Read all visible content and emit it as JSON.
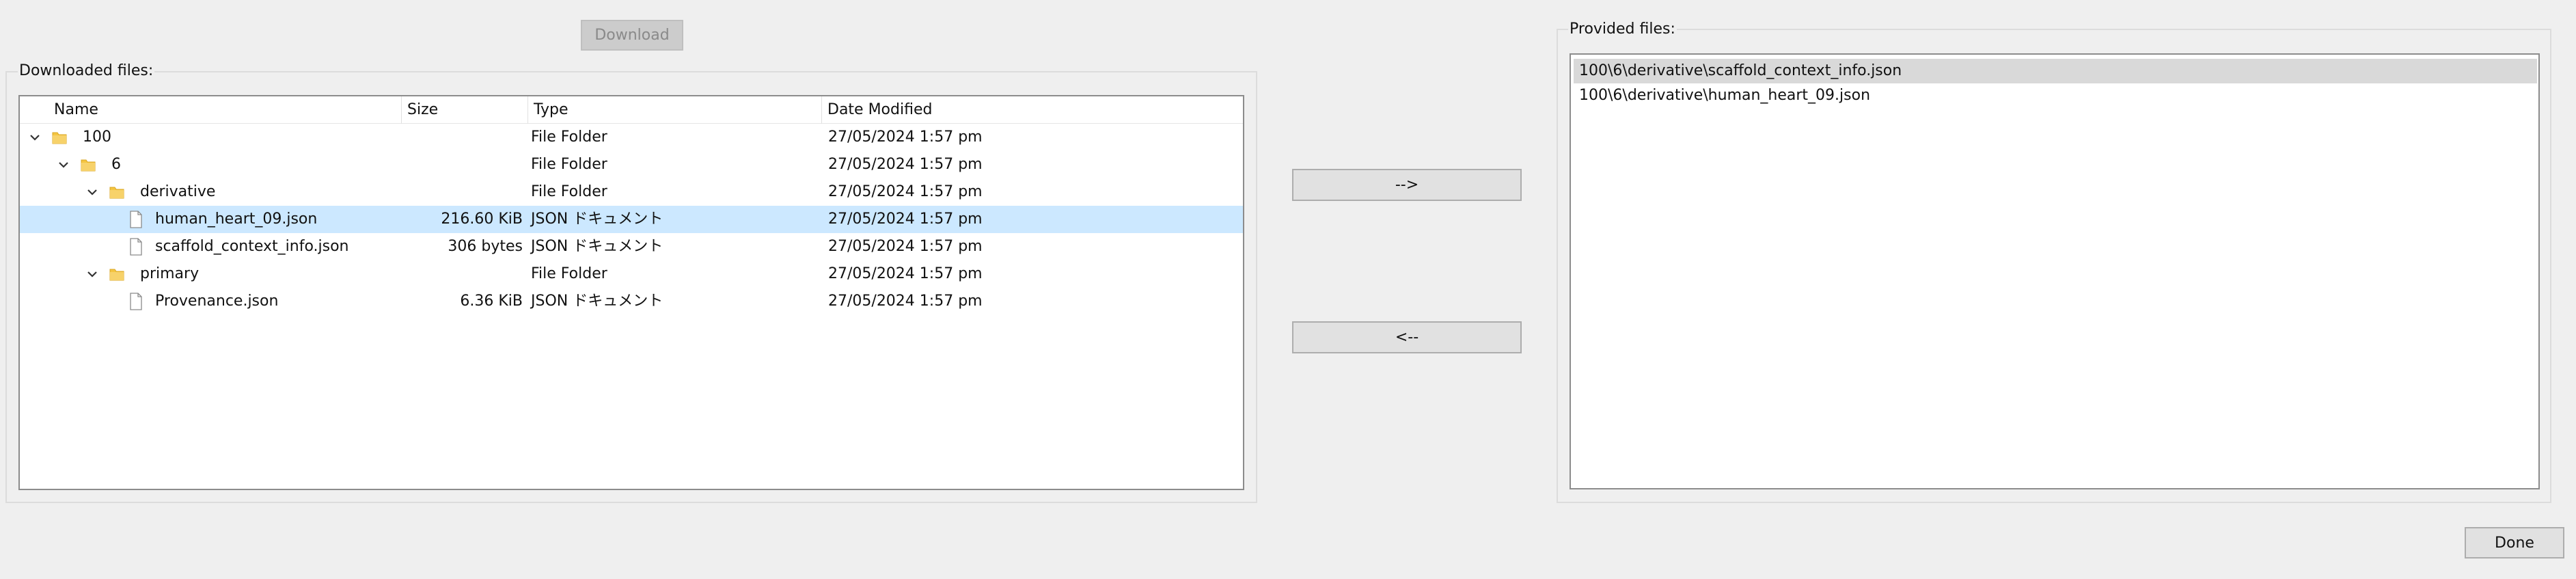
{
  "download_button": {
    "label": "Download",
    "disabled": true
  },
  "downloaded": {
    "title": "Downloaded files:",
    "columns": [
      "Name",
      "Size",
      "Type",
      "Date Modified"
    ],
    "rows": [
      {
        "name": "100",
        "size": "",
        "type": "File Folder",
        "date": "27/05/2024 1:57 pm",
        "depth": 0,
        "kind": "folder",
        "expanded": true,
        "selected": false
      },
      {
        "name": "6",
        "size": "",
        "type": "File Folder",
        "date": "27/05/2024 1:57 pm",
        "depth": 1,
        "kind": "folder",
        "expanded": true,
        "selected": false
      },
      {
        "name": "derivative",
        "size": "",
        "type": "File Folder",
        "date": "27/05/2024 1:57 pm",
        "depth": 2,
        "kind": "folder",
        "expanded": true,
        "selected": false
      },
      {
        "name": "human_heart_09.json",
        "size": "216.60 KiB",
        "type": "JSON ドキュメント",
        "date": "27/05/2024 1:57 pm",
        "depth": 3,
        "kind": "file",
        "expanded": false,
        "selected": true
      },
      {
        "name": "scaffold_context_info.json",
        "size": "306 bytes",
        "type": "JSON ドキュメント",
        "date": "27/05/2024 1:57 pm",
        "depth": 3,
        "kind": "file",
        "expanded": false,
        "selected": false
      },
      {
        "name": "primary",
        "size": "",
        "type": "File Folder",
        "date": "27/05/2024 1:57 pm",
        "depth": 2,
        "kind": "folder",
        "expanded": true,
        "selected": false
      },
      {
        "name": "Provenance.json",
        "size": "6.36 KiB",
        "type": "JSON ドキュメント",
        "date": "27/05/2024 1:57 pm",
        "depth": 3,
        "kind": "file",
        "expanded": false,
        "selected": false
      }
    ]
  },
  "transfer": {
    "add_label": "-->",
    "remove_label": "<--"
  },
  "provided": {
    "title": "Provided files:",
    "items": [
      {
        "label": "100\\6\\derivative\\scaffold_context_info.json",
        "selected": true
      },
      {
        "label": "100\\6\\derivative\\human_heart_09.json",
        "selected": false
      }
    ]
  },
  "done_button": {
    "label": "Done"
  },
  "colors": {
    "selection": "#cce8ff",
    "list_selection": "#d9d9d9",
    "folder": "#f4c542",
    "background": "#efefef"
  }
}
